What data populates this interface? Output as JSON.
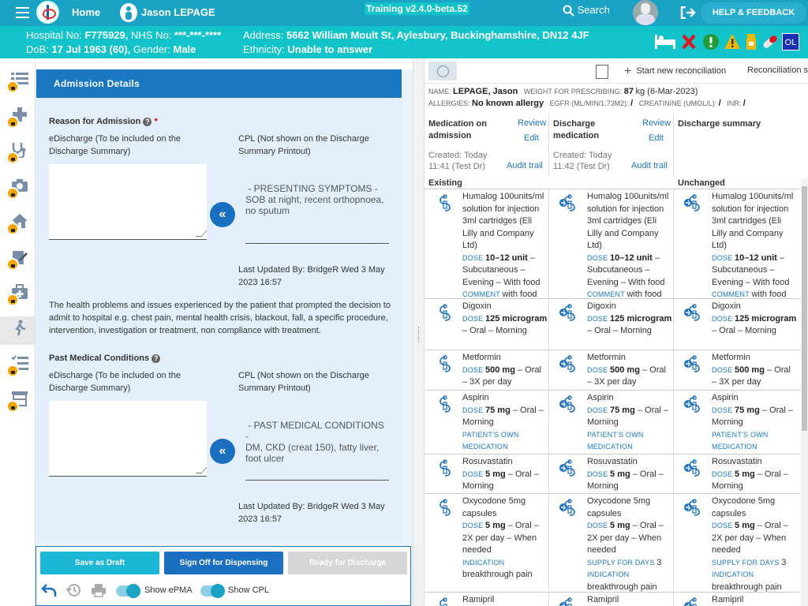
{
  "topbar": {
    "home": "Home",
    "patient_name": "Jason LEPAGE",
    "training": "Training v2.4.0-beta.52",
    "search": "Search",
    "help": "HELP & FEEDBACK"
  },
  "patient_bar": {
    "hospital_label": "Hospital No:",
    "hospital_no": "F775929,",
    "nhs_label": "NHS No:",
    "nhs_no": "***-***-****",
    "dob_label": "DoB:",
    "dob": "17 Jul 1963 (60),",
    "gender_label": "Gender:",
    "gender": "Male",
    "address_label": "Address:",
    "address": "5662 William Moult St, Aylesbury, Buckinghamshire, DN12 4JF",
    "ethnicity_label": "Ethnicity:",
    "ethnicity": "Unable to answer",
    "ol_badge": "OL"
  },
  "admission": {
    "header": "Admission Details",
    "reason_title": "Reason for Admission",
    "required_mark": "*",
    "edischarge_label": "eDischarge (To be included on the Discharge Summary)",
    "cpl_label": "CPL (Not shown on the Discharge Summary Printout)",
    "reason_cpl_text": " - PRESENTING SYMPTOMS -\nSOB at night, recent orthopnoea, no sputum",
    "reason_updated": "Last Updated By: BridgeR Wed 3 May 2023 16:57",
    "help_text": "The health problems and issues experienced by the patient that prompted the decision to admit to hospital e.g. chest pain, mental health crisis, blackout, fall,  a specific procedure, intervention, investigation or treatment, non compliance with treatment.",
    "pmc_title": "Past Medical Conditions",
    "pmc_cpl_text": " - PAST MEDICAL CONDITIONS -\nDM, CKD (creat 150), fatty liver, foot ulcer",
    "pmc_updated": "Last Updated By: BridgeR Wed 3 May 2023 16:57",
    "copy_glyph": "«"
  },
  "footer": {
    "save_draft": "Save as Draft",
    "sign_off": "Sign Off for Dispensing",
    "ready": "Ready for Discharge",
    "show_epma": "Show ePMA",
    "show_cpl": "Show CPL"
  },
  "reconciliation": {
    "toolbar": {
      "start": "Start new reconciliation",
      "recon": "Reconciliation st"
    },
    "patient": {
      "name_label": "NAME:",
      "name": "LEPAGE, Jason",
      "weight_label": "WEIGHT FOR PRESCRIBING:",
      "weight": "87",
      "weight_unit": "kg (6-Mar-2023)",
      "allergies_label": "ALLERGIES:",
      "allergies": "No known allergy",
      "egfr_label": "EGFR (ML/MIN/1.73M2):",
      "egfr": "/",
      "creat_label": "CREATININE (UMOL/L):",
      "creat": "/",
      "inr_label": "INR:",
      "inr": "/"
    },
    "columns": [
      {
        "title": "Medication on admission",
        "review": "Review",
        "edit": "Edit",
        "created": "Created: Today",
        "time": "11:41 (Test Dr)",
        "audit": "Audit trail"
      },
      {
        "title": "Discharge medication",
        "review": "Review",
        "edit": "Edit",
        "created": "Created: Today",
        "time": "11:42 (Test Dr)",
        "audit": "Audit trail"
      },
      {
        "title": "Discharge summary"
      }
    ],
    "sections": {
      "existing": "Existing",
      "unchanged": "Unchanged"
    },
    "meds": [
      {
        "name": "Humalog 100units/ml solution for injection 3ml cartridges (Eli Lilly and Company Ltd)",
        "dose": "10–12 unit",
        "route": "– Subcutaneous – Evening – With food",
        "extra_label": "COMMENT",
        "extra": "with food"
      },
      {
        "name": "Digoxin",
        "dose": "125 microgram",
        "route": "– Oral – Morning"
      },
      {
        "name": "Metformin",
        "dose": "500 mg",
        "route": "– Oral – 3X per day"
      },
      {
        "name": "Aspirin",
        "dose": "75 mg",
        "route": "– Oral – Morning",
        "flag": "PATIENT'S OWN MEDICATION"
      },
      {
        "name": "Rosuvastatin",
        "dose": "5 mg",
        "route": "– Oral – Morning"
      },
      {
        "name": "Oxycodone 5mg capsules",
        "dose": "5 mg",
        "route": "– Oral – 2X per day – When needed",
        "supply_label": "SUPPLY FOR DAYS",
        "supply": "3",
        "extra_label": "INDICATION",
        "extra": "breakthrough pain"
      },
      {
        "name": "Ramipril"
      }
    ],
    "dose_label": "DOSE"
  }
}
